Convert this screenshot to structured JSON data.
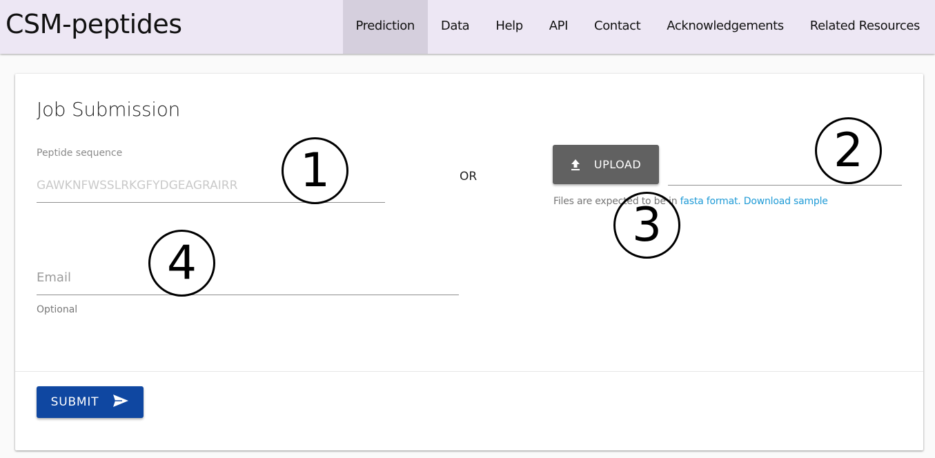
{
  "app": {
    "brand": "CSM-peptides"
  },
  "nav": {
    "items": [
      {
        "label": "Prediction",
        "active": true
      },
      {
        "label": "Data"
      },
      {
        "label": "Help"
      },
      {
        "label": "API"
      },
      {
        "label": "Contact"
      },
      {
        "label": "Acknowledgements"
      },
      {
        "label": "Related Resources"
      }
    ]
  },
  "form": {
    "title": "Job Submission",
    "sequence": {
      "label": "Peptide sequence",
      "placeholder": "GAWKNFWSSLRKGFYDGEAGRAIRR",
      "value": ""
    },
    "or_label": "OR",
    "upload": {
      "label": "UPLOAD",
      "icon": "upload-icon",
      "file_value": ""
    },
    "hint": {
      "prefix": "Files are expected to be in ",
      "format_link": "fasta format.",
      "sample_link": "Download sample"
    },
    "email": {
      "placeholder": "Email",
      "value": "",
      "helper": "Optional"
    },
    "submit": {
      "label": "SUBMIT",
      "icon": "send-icon"
    }
  },
  "annotations": [
    "1",
    "2",
    "3",
    "4"
  ],
  "colors": {
    "navbar_bg": "#ede7f4",
    "nav_active_bg": "#d5cfdd",
    "upload_btn": "#616161",
    "submit_btn": "#0f47a1",
    "link": "#1e9ad6"
  }
}
